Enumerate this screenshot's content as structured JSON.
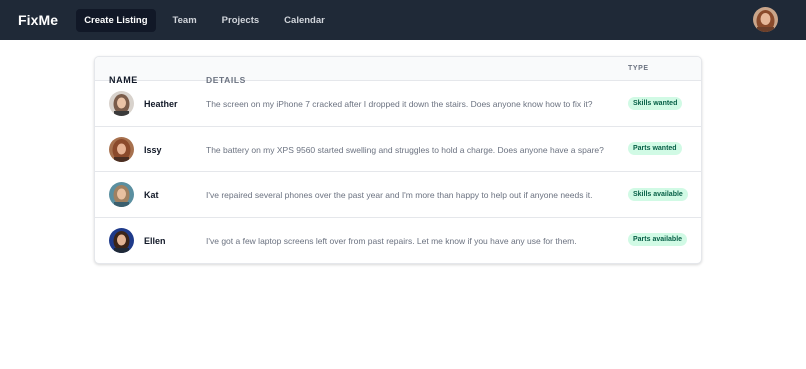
{
  "app": {
    "name": "FixMe"
  },
  "nav": {
    "items": [
      {
        "label": "Create Listing",
        "active": true
      },
      {
        "label": "Team"
      },
      {
        "label": "Projects"
      },
      {
        "label": "Calendar"
      }
    ]
  },
  "table": {
    "headers": {
      "name": "NAME",
      "details": "DETAILS",
      "type": "TYPE"
    },
    "rows": [
      {
        "name": "Heather",
        "details": "The screen on my iPhone 7 cracked after I dropped it down the stairs. Does anyone know how to fix it?",
        "type": "Skills wanted"
      },
      {
        "name": "Issy",
        "details": "The battery on my XPS 9560 started swelling and struggles to hold a charge. Does anyone have a spare?",
        "type": "Parts wanted"
      },
      {
        "name": "Kat",
        "details": "I've repaired several phones over the past year and I'm more than happy to help out if anyone needs it.",
        "type": "Skills available"
      },
      {
        "name": "Ellen",
        "details": "I've got a few laptop screens left over from past repairs. Let me know if you have any use for them.",
        "type": "Parts available"
      }
    ]
  },
  "colors": {
    "navbar": "#1f2937",
    "badge_bg": "#d1fae5",
    "badge_text": "#065f46"
  }
}
